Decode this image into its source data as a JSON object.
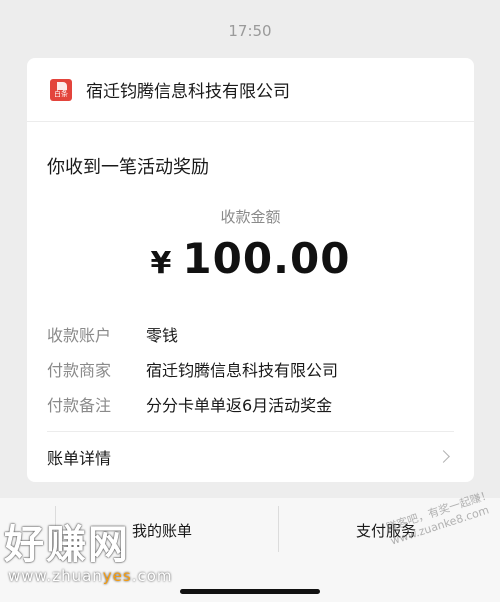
{
  "status_time": "17:50",
  "card": {
    "logo_text": "白条",
    "merchant": "宿迁钧腾信息科技有限公司",
    "title": "你收到一笔活动奖励",
    "amount_label": "收款金额",
    "currency": "¥",
    "amount": "100.00",
    "rows": [
      {
        "key": "收款账户",
        "value": "零钱"
      },
      {
        "key": "付款商家",
        "value": "宿迁钧腾信息科技有限公司"
      },
      {
        "key": "付款备注",
        "value": "分分卡单单返6月活动奖金"
      }
    ],
    "detail_label": "账单详情"
  },
  "bottom_tabs": [
    "我的账单",
    "支付服务"
  ],
  "watermark": {
    "text": "好赚网",
    "url_prefix": "www.zhuan",
    "url_highlight": "yes",
    "url_suffix": ".com",
    "side_text": "赚客吧，有奖一起赚！www.zuanke8.com"
  },
  "colors": {
    "logo": "#e3443c",
    "background": "#ededed"
  }
}
